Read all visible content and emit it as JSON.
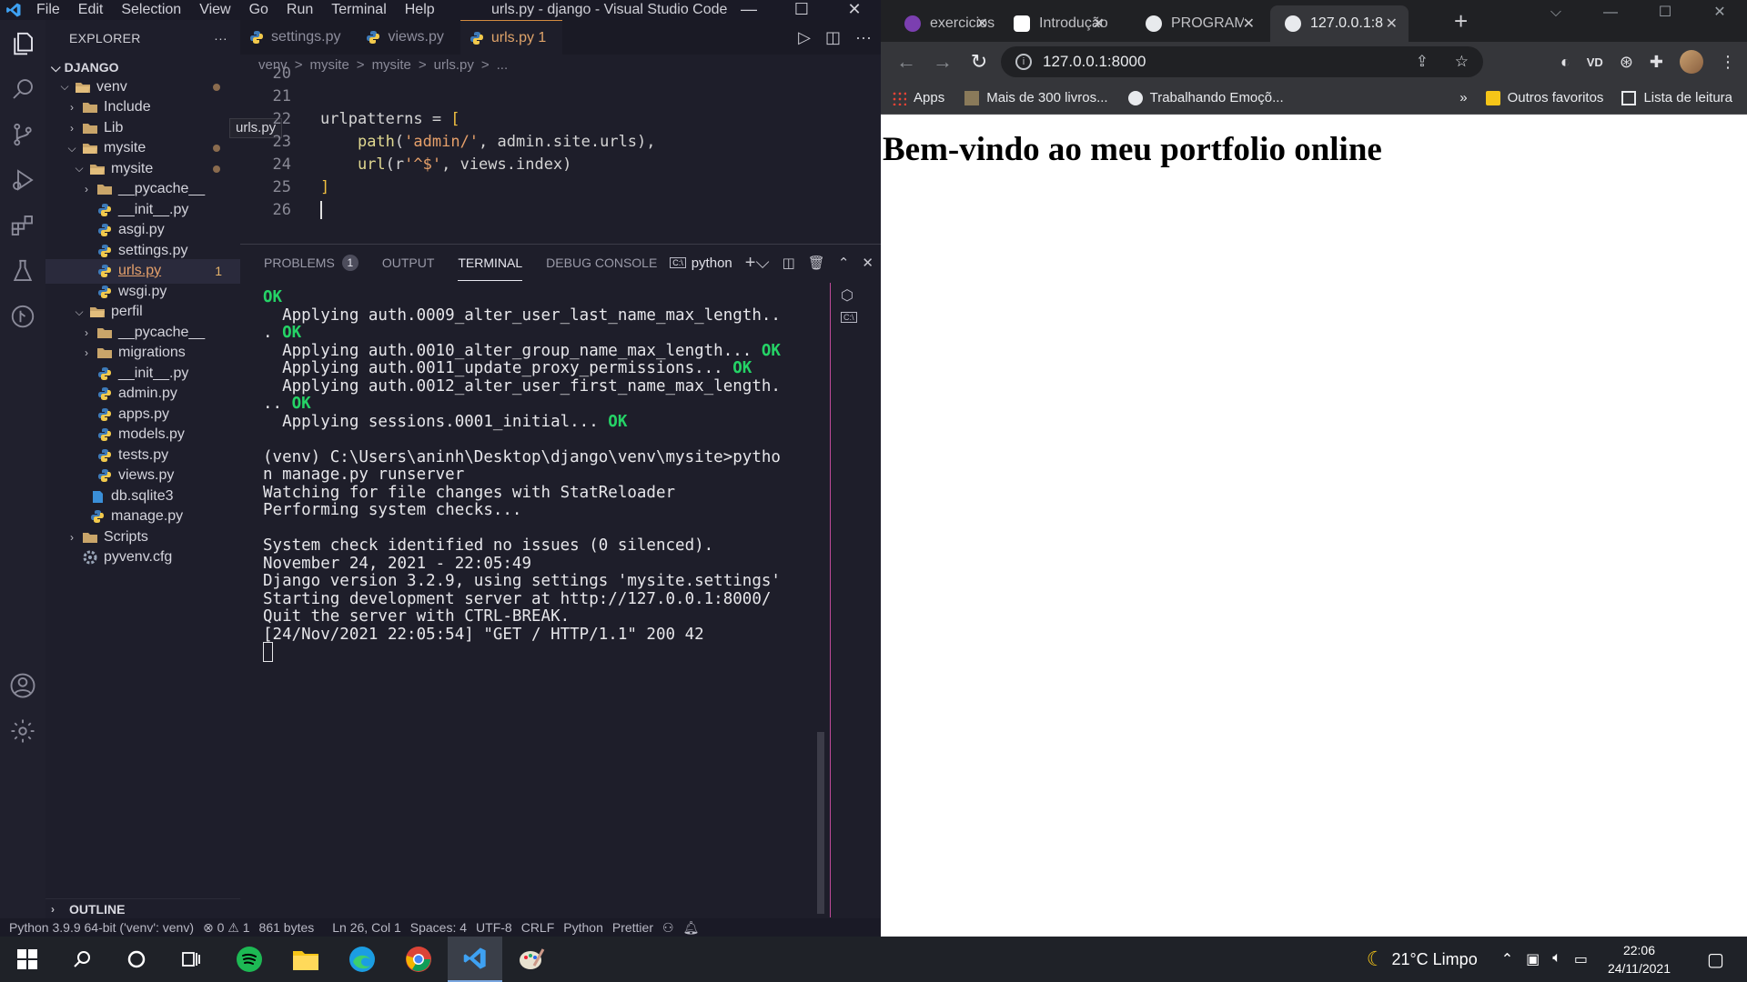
{
  "vscode": {
    "menu": [
      "File",
      "Edit",
      "Selection",
      "View",
      "Go",
      "Run",
      "Terminal",
      "Help"
    ],
    "window_title": "urls.py - django - Visual Studio Code",
    "explorer": {
      "header": "EXPLORER",
      "more": "···",
      "root": "DJANGO",
      "tooltip": "urls.py",
      "outline": "OUTLINE",
      "tree": [
        {
          "label": "venv",
          "kind": "folder-open",
          "modified": true
        },
        {
          "label": "Include",
          "kind": "folder-closed"
        },
        {
          "label": "Lib",
          "kind": "folder-closed"
        },
        {
          "label": "mysite",
          "kind": "folder-open",
          "modified": true
        },
        {
          "label": "mysite",
          "kind": "folder-open",
          "modified": true
        },
        {
          "label": "__pycache__",
          "kind": "folder-closed"
        },
        {
          "label": "__init__.py",
          "kind": "python"
        },
        {
          "label": "asgi.py",
          "kind": "python"
        },
        {
          "label": "settings.py",
          "kind": "python"
        },
        {
          "label": "urls.py",
          "kind": "python",
          "problems": "1"
        },
        {
          "label": "wsgi.py",
          "kind": "python"
        },
        {
          "label": "perfil",
          "kind": "folder-open"
        },
        {
          "label": "__pycache__",
          "kind": "folder-closed"
        },
        {
          "label": "migrations",
          "kind": "folder-closed"
        },
        {
          "label": "__init__.py",
          "kind": "python"
        },
        {
          "label": "admin.py",
          "kind": "python"
        },
        {
          "label": "apps.py",
          "kind": "python"
        },
        {
          "label": "models.py",
          "kind": "python"
        },
        {
          "label": "tests.py",
          "kind": "python"
        },
        {
          "label": "views.py",
          "kind": "python"
        },
        {
          "label": "db.sqlite3",
          "kind": "db"
        },
        {
          "label": "manage.py",
          "kind": "python"
        },
        {
          "label": "Scripts",
          "kind": "folder-closed"
        },
        {
          "label": "pyvenv.cfg",
          "kind": "gear"
        }
      ]
    },
    "tabs": [
      {
        "label": "settings.py",
        "active": false
      },
      {
        "label": "views.py",
        "active": false
      },
      {
        "label": "urls.py 1",
        "active": true
      }
    ],
    "breadcrumbs": [
      "venv",
      ">",
      "mysite",
      ">",
      "mysite",
      ">",
      "urls.py",
      ">",
      "..."
    ],
    "code_lines": [
      {
        "num": "20",
        "text": ""
      },
      {
        "num": "21",
        "text": ""
      },
      {
        "num": "22",
        "text": "urlpatterns = ["
      },
      {
        "num": "23",
        "text": "    path('admin/', admin.site.urls),"
      },
      {
        "num": "24",
        "text": "    url(r'^$', views.index)"
      },
      {
        "num": "25",
        "text": "]"
      },
      {
        "num": "26",
        "text": ""
      }
    ],
    "panel": {
      "tabs": [
        "PROBLEMS",
        "OUTPUT",
        "TERMINAL",
        "DEBUG CONSOLE"
      ],
      "problems_count": "1",
      "shell": "python"
    },
    "terminal_lines": [
      {
        "text": "",
        "ok": "OK"
      },
      {
        "text": "  Applying auth.0009_alter_user_last_name_max_length..",
        "ok": ""
      },
      {
        "text": ". ",
        "ok": "OK"
      },
      {
        "text": "  Applying auth.0010_alter_group_name_max_length... ",
        "ok": "OK"
      },
      {
        "text": "  Applying auth.0011_update_proxy_permissions... ",
        "ok": "OK"
      },
      {
        "text": "  Applying auth.0012_alter_user_first_name_max_length.",
        "ok": ""
      },
      {
        "text": ".. ",
        "ok": "OK"
      },
      {
        "text": "  Applying sessions.0001_initial... ",
        "ok": "OK"
      },
      {
        "text": "",
        "ok": ""
      },
      {
        "text": "(venv) C:\\Users\\aninh\\Desktop\\django\\venv\\mysite>pytho",
        "ok": ""
      },
      {
        "text": "n manage.py runserver",
        "ok": ""
      },
      {
        "text": "Watching for file changes with StatReloader",
        "ok": ""
      },
      {
        "text": "Performing system checks...",
        "ok": ""
      },
      {
        "text": "",
        "ok": ""
      },
      {
        "text": "System check identified no issues (0 silenced).",
        "ok": ""
      },
      {
        "text": "November 24, 2021 - 22:05:49",
        "ok": ""
      },
      {
        "text": "Django version 3.2.9, using settings 'mysite.settings'",
        "ok": ""
      },
      {
        "text": "Starting development server at http://127.0.0.1:8000/",
        "ok": ""
      },
      {
        "text": "Quit the server with CTRL-BREAK.",
        "ok": ""
      },
      {
        "text": "[24/Nov/2021 22:05:54] \"GET / HTTP/1.1\" 200 42",
        "ok": ""
      }
    ],
    "status": {
      "interpreter": "Python 3.9.9 64-bit ('venv': venv)",
      "problems": "⊗ 0 ⚠ 1",
      "size": "861 bytes",
      "position": "Ln 26, Col 1",
      "spaces": "Spaces: 4",
      "encoding": "UTF-8",
      "eol": "CRLF",
      "language": "Python",
      "formatter": "Prettier"
    }
  },
  "browser": {
    "tabs": [
      {
        "label": "exercicios",
        "favicon_color": "#7b3fb0",
        "active": false
      },
      {
        "label": "Introdução",
        "favicon_color": "#ffffff",
        "active": false
      },
      {
        "label": "PROGRAM",
        "favicon_color": "#e8eaed",
        "active": false
      },
      {
        "label": "127.0.0.1:8",
        "favicon_color": "#e8eaed",
        "active": true
      }
    ],
    "address": "127.0.0.1:8000",
    "bookmarks": [
      {
        "label": "Apps"
      },
      {
        "label": "Mais de 300 livros..."
      },
      {
        "label": "Trabalhando Emoçõ..."
      }
    ],
    "bookmarks_overflow": "»",
    "bookmarks_right": [
      {
        "label": "Outros favoritos"
      },
      {
        "label": "Lista de leitura"
      }
    ],
    "page_heading": "Bem-vindo ao meu portfolio online"
  },
  "taskbar": {
    "weather": "21°C  Limpo",
    "time": "22:06",
    "date": "24/11/2021"
  },
  "colors": {
    "vscode_bg": "#1e1e2a",
    "terminal_ok": "#25d366",
    "active_tab_text": "#e0a46a",
    "browser_chrome": "#35363a"
  }
}
